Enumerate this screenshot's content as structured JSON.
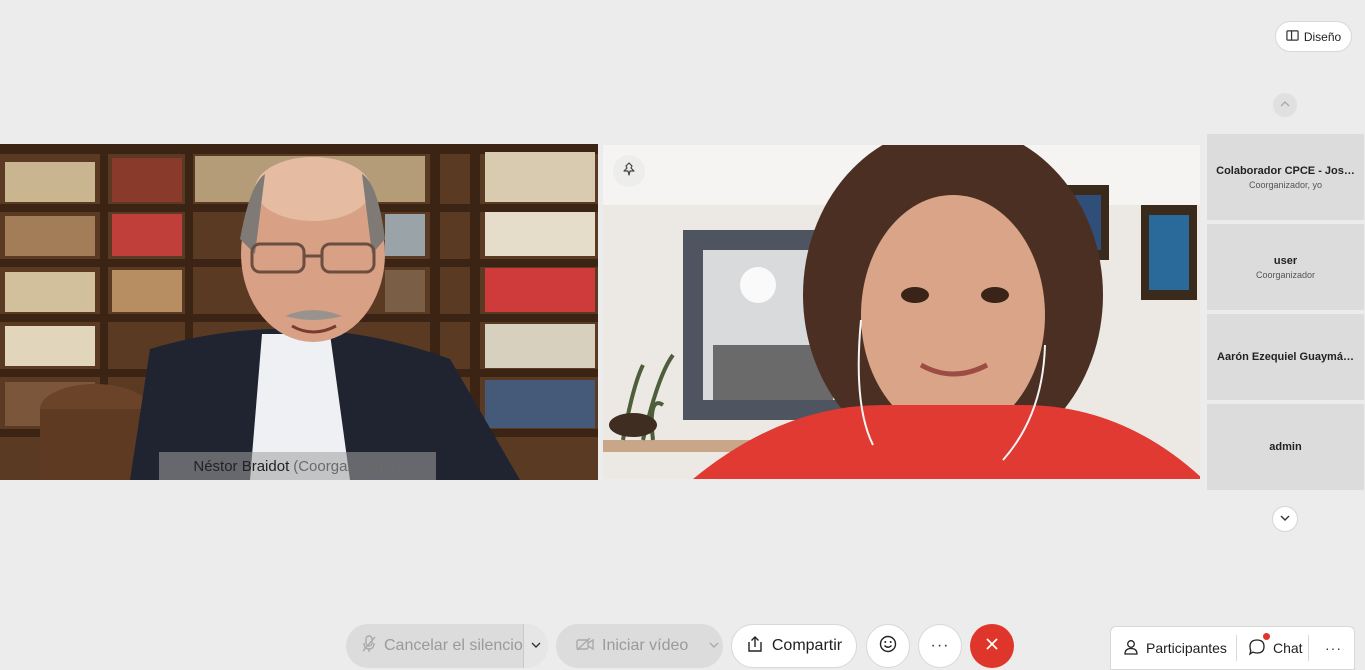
{
  "top_strip": {
    "text": ""
  },
  "layout_button": {
    "label": "Diseño",
    "icon": "layout-icon"
  },
  "stage": {
    "tiles": [
      {
        "name": "Néstor Braidot",
        "role": "(Coorganizador)"
      },
      {
        "pin_icon": "pin-icon"
      }
    ]
  },
  "participants": [
    {
      "name": "Colaborador CPCE - Jos…",
      "role": "Coorganizador, yo"
    },
    {
      "name": "user",
      "role": "Coorganizador"
    },
    {
      "name": "Aarón Ezequiel Guaymá…",
      "role": ""
    },
    {
      "name": "admin",
      "role": ""
    }
  ],
  "controls": {
    "mute_label": "Cancelar el silencio",
    "video_label": "Iniciar vídeo",
    "share_label": "Compartir",
    "more_symbol": "···",
    "participants_label": "Participantes",
    "chat_label": "Chat",
    "overflow_symbol": "···"
  },
  "colors": {
    "background": "#ececec",
    "leave_red": "#e0352a",
    "participant_tile": "#dcdcdc",
    "disabled_text": "#9a9a9a"
  }
}
